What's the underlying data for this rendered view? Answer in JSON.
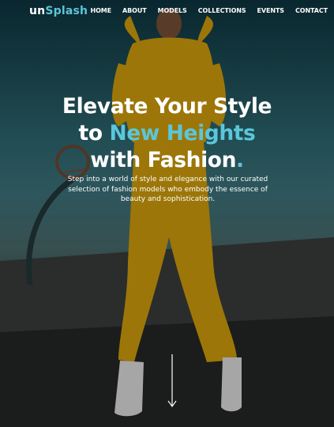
{
  "brand": {
    "part1": "un",
    "part2": "Splash"
  },
  "nav": {
    "items": [
      "HOME",
      "ABOUT",
      "MODELS",
      "COLLECTIONS",
      "EVENTS",
      "CONTACT"
    ]
  },
  "hero": {
    "line1": "Elevate Your Style",
    "line2_prefix": "to ",
    "line2_accent": "New Heights",
    "line3": "with Fashion",
    "line3_dot": ".",
    "subtext": "Step into a world of style and elegance with our curated selection of fashion models who embody the essence of beauty and sophistication."
  },
  "colors": {
    "accent": "#5bc6d9",
    "outfit": "#d8a40c",
    "text": "#ffffff"
  },
  "icons": {
    "scroll": "arrow-down-icon"
  }
}
